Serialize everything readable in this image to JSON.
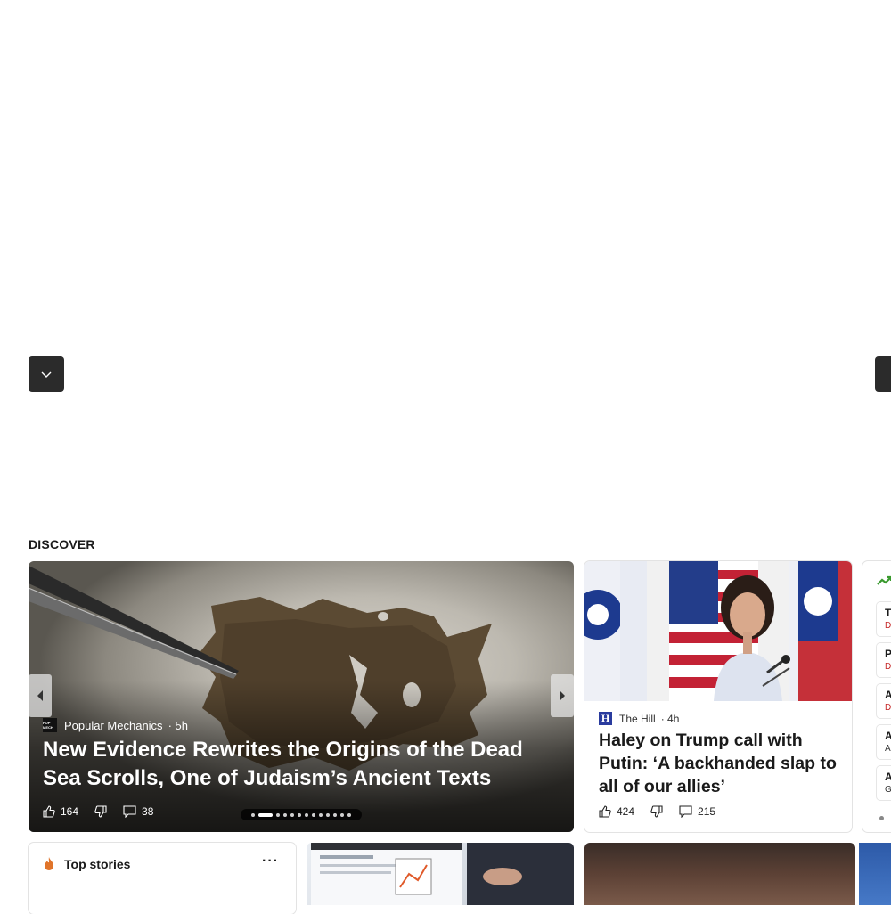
{
  "discover": {
    "label": "DISCOVER"
  },
  "hero": {
    "source": "Popular Mechanics",
    "time": "· 5h",
    "logo_text": "POP MECH",
    "headline": "New Evidence Rewrites the Origins of the Dead Sea Scrolls, One of Judaism’s Ancient Texts",
    "likes": "164",
    "comments": "38",
    "slides_total": 13,
    "slide_active": 2
  },
  "news": {
    "source": "The Hill",
    "time": "· 4h",
    "logo_text": "H",
    "headline": "Haley on Trump call with Putin: ‘A backhanded slap to all of our allies’",
    "likes": "424",
    "comments": "215"
  },
  "markets": {
    "rows": [
      {
        "title": "T",
        "sub": "D"
      },
      {
        "title": "P",
        "sub": "D"
      },
      {
        "title": "A",
        "sub": "D"
      },
      {
        "title": "A",
        "sub": "A"
      },
      {
        "title": "A",
        "sub": "G"
      }
    ],
    "colors": {
      "down": "#c62828",
      "neutral": "#333333",
      "up_icon": "#3a9a2e"
    }
  },
  "top_stories": {
    "title": "Top stories",
    "more": "···"
  },
  "icons": {
    "collapse": "chevron-down-icon",
    "like": "thumbs-up-icon",
    "dislike": "thumbs-down-icon",
    "comment": "comment-icon",
    "prev": "caret-left-icon",
    "next": "caret-right-icon",
    "flame": "flame-icon"
  },
  "colors": {
    "dark_button": "#2b2b2b",
    "accent_hill": "#2a3b9e",
    "flame": "#e0742a"
  }
}
